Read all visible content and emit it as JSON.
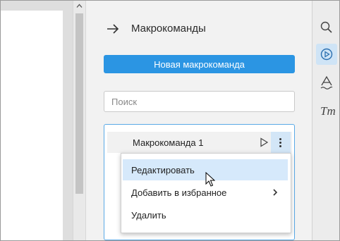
{
  "panel": {
    "title": "Макрокоманды",
    "new_macro_label": "Новая макрокоманда",
    "search_placeholder": "Поиск"
  },
  "macros": [
    {
      "name": "Макрокоманда 1"
    }
  ],
  "context_menu": {
    "items": [
      {
        "label": "Редактировать",
        "highlighted": true
      },
      {
        "label": "Добавить в избранное",
        "has_submenu": true
      },
      {
        "label": "Удалить"
      }
    ]
  },
  "toolbar": {
    "tools": [
      {
        "icon": "search-icon"
      },
      {
        "icon": "macros-play-icon",
        "active": true
      },
      {
        "icon": "text-style-icon"
      },
      {
        "icon": "font-size-icon",
        "glyph": "Tт"
      }
    ]
  },
  "colors": {
    "accent": "#2b95e3",
    "selection": "#d6e9fb",
    "active_tool": "#cfe4f6"
  }
}
